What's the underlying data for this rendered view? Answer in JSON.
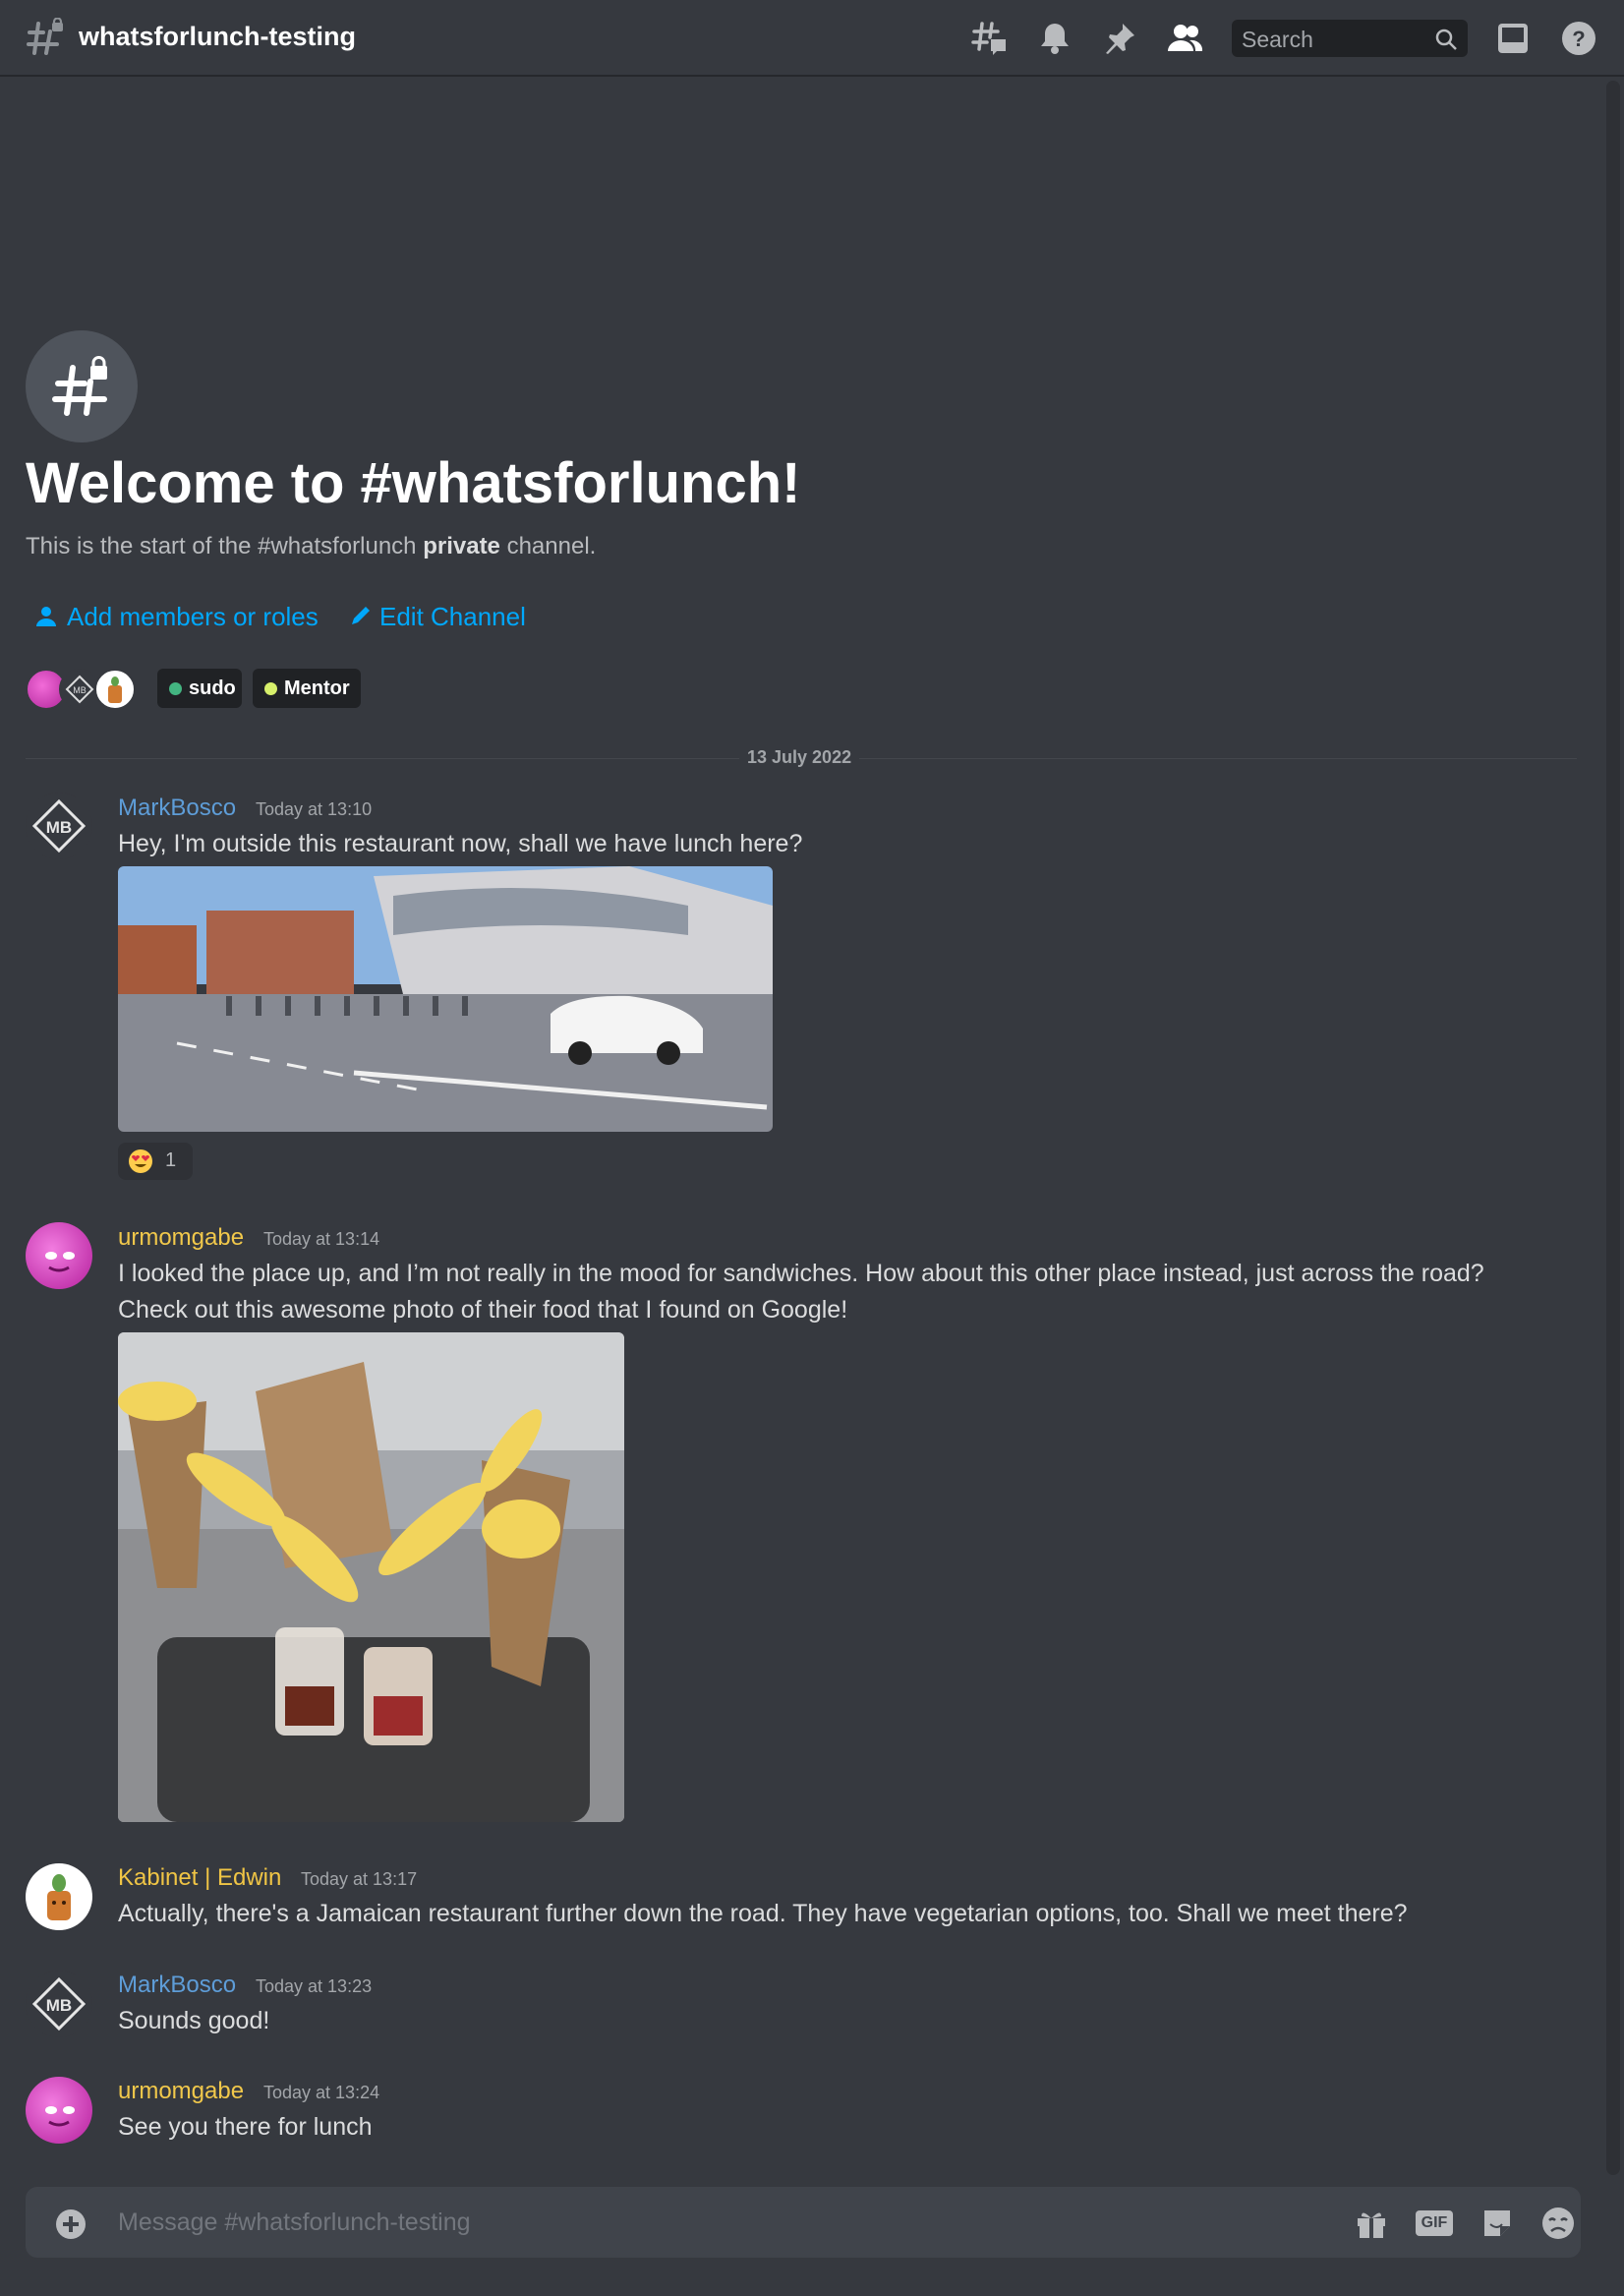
{
  "header": {
    "channel_name": "whatsforlunch-testing",
    "icons": [
      "threads-icon",
      "notification-bell-icon",
      "pin-icon",
      "member-list-icon",
      "inbox-icon",
      "help-icon"
    ],
    "search_placeholder": "Search"
  },
  "welcome": {
    "title": "Welcome to #whatsforlunch!",
    "description_prefix": "This is the start of the #whatsforlunch ",
    "description_bold": "private",
    "description_suffix": " channel.",
    "add_members_label": "Add members or roles",
    "edit_channel_label": "Edit Channel",
    "roles": [
      {
        "name": "sudo",
        "color": "#43b581"
      },
      {
        "name": "Mentor",
        "color": "#d7f06b"
      }
    ]
  },
  "date_divider": "13 July 2022",
  "messages": [
    {
      "user": "MarkBosco",
      "color": "#5e9dd8",
      "time": "Today at 13:10",
      "text": "Hey, I'm outside this restaurant now, shall we have lunch here?"
    },
    {
      "reaction_emoji": "heart-eyes-emoji",
      "reaction_count": "1"
    },
    {
      "user": "urmomgabe",
      "color": "#f1c84b",
      "time": "Today at 13:14",
      "text_line1": "I looked the place up, and I’m not really in the mood for sandwiches. How about this other place instead, just across the road?",
      "text_line2": "Check out this awesome photo of their food that I found on Google!"
    },
    {
      "user": "Kabinet | Edwin",
      "color": "#f0c545",
      "time": "Today at 13:17",
      "text": "Actually, there's a Jamaican restaurant further down the road. They have vegetarian options, too. Shall we meet there?"
    },
    {
      "user": "MarkBosco",
      "color": "#5e9dd8",
      "time": "Today at 13:23",
      "text": "Sounds good!"
    },
    {
      "user": "urmomgabe",
      "color": "#f1c84b",
      "time": "Today at 13:24",
      "text": "See you there for lunch"
    }
  ],
  "composer": {
    "placeholder": "Message #whatsforlunch-testing",
    "gif_label": "GIF"
  }
}
